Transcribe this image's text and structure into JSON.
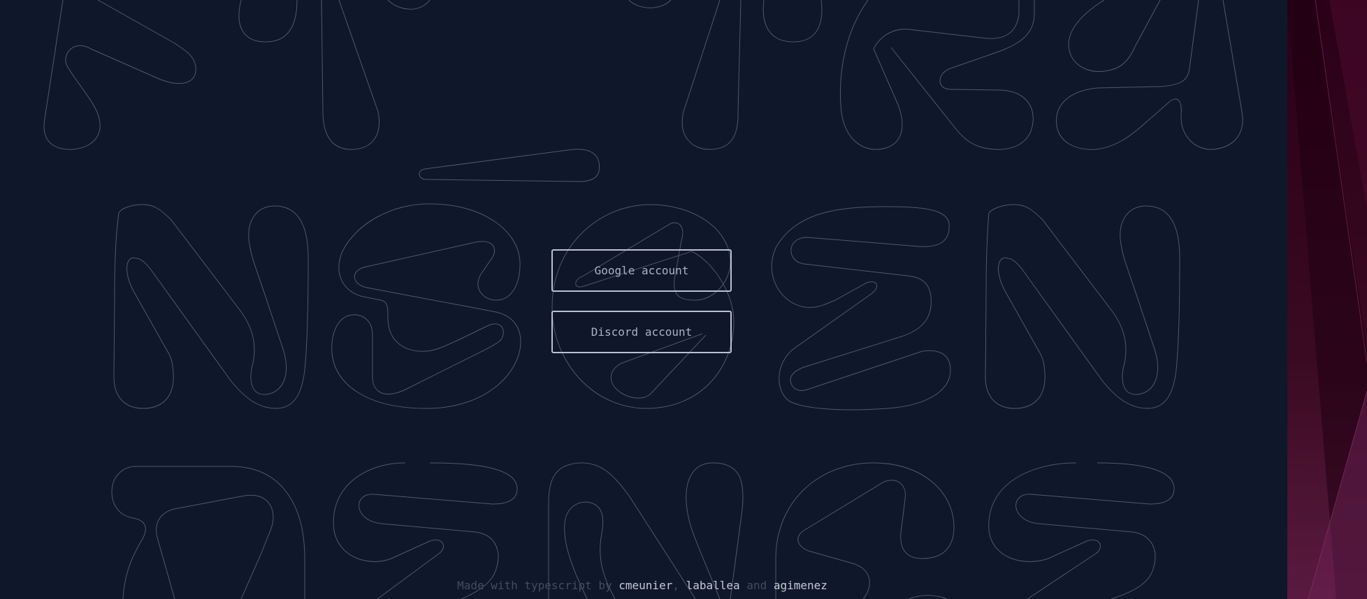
{
  "auth": {
    "google_label": "Google account",
    "discord_label": "Discord account"
  },
  "footer": {
    "prefix": "Made with typescript by",
    "authors": [
      "cmeunier",
      "laballea",
      "agimenez"
    ],
    "separator": ",",
    "conjunction": "and"
  },
  "colors": {
    "background": "#0f172a",
    "outline": "#5b6678",
    "button_border": "#b8c2d3",
    "side_accent": "#5a1a40"
  }
}
